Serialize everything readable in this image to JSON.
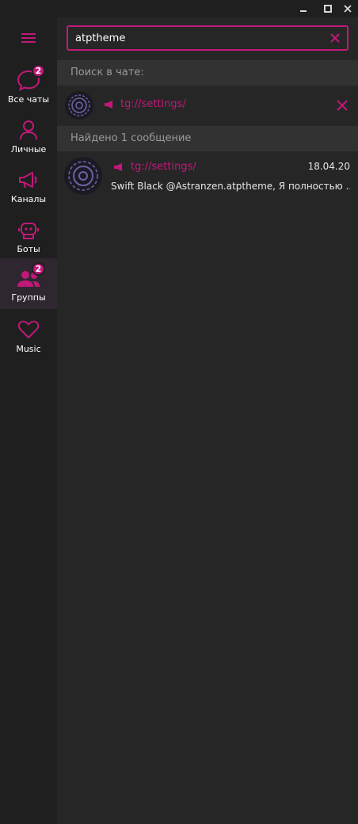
{
  "window": {
    "minimize_glyph": "—",
    "maximize_glyph": "☐",
    "close_glyph": "✕"
  },
  "colors": {
    "accent": "#c2187a",
    "background": "#262626",
    "sidebar": "#1f1f1f",
    "section_header": "#323232"
  },
  "sidebar": {
    "menu_icon": "hamburger-icon",
    "folders": [
      {
        "label": "Все чаты",
        "icon": "chats-icon",
        "badge": "2"
      },
      {
        "label": "Личные",
        "icon": "person-icon"
      },
      {
        "label": "Каналы",
        "icon": "megaphone-icon"
      },
      {
        "label": "Боты",
        "icon": "bot-icon"
      },
      {
        "label": "Группы",
        "icon": "group-icon",
        "badge": "2",
        "active": true
      },
      {
        "label": "Music",
        "icon": "heart-icon"
      }
    ]
  },
  "search": {
    "value": "atptheme",
    "clear_icon": "close-icon"
  },
  "search_in_chat": {
    "header": "Поиск в чате:",
    "peer_name": "tg://settings/"
  },
  "results": {
    "header": "Найдено 1 сообщение",
    "items": [
      {
        "peer_name": "tg://settings/",
        "date": "18.04.20",
        "snippet": "Swift Black @Astranzen.atptheme, Я полностью ..."
      }
    ]
  }
}
